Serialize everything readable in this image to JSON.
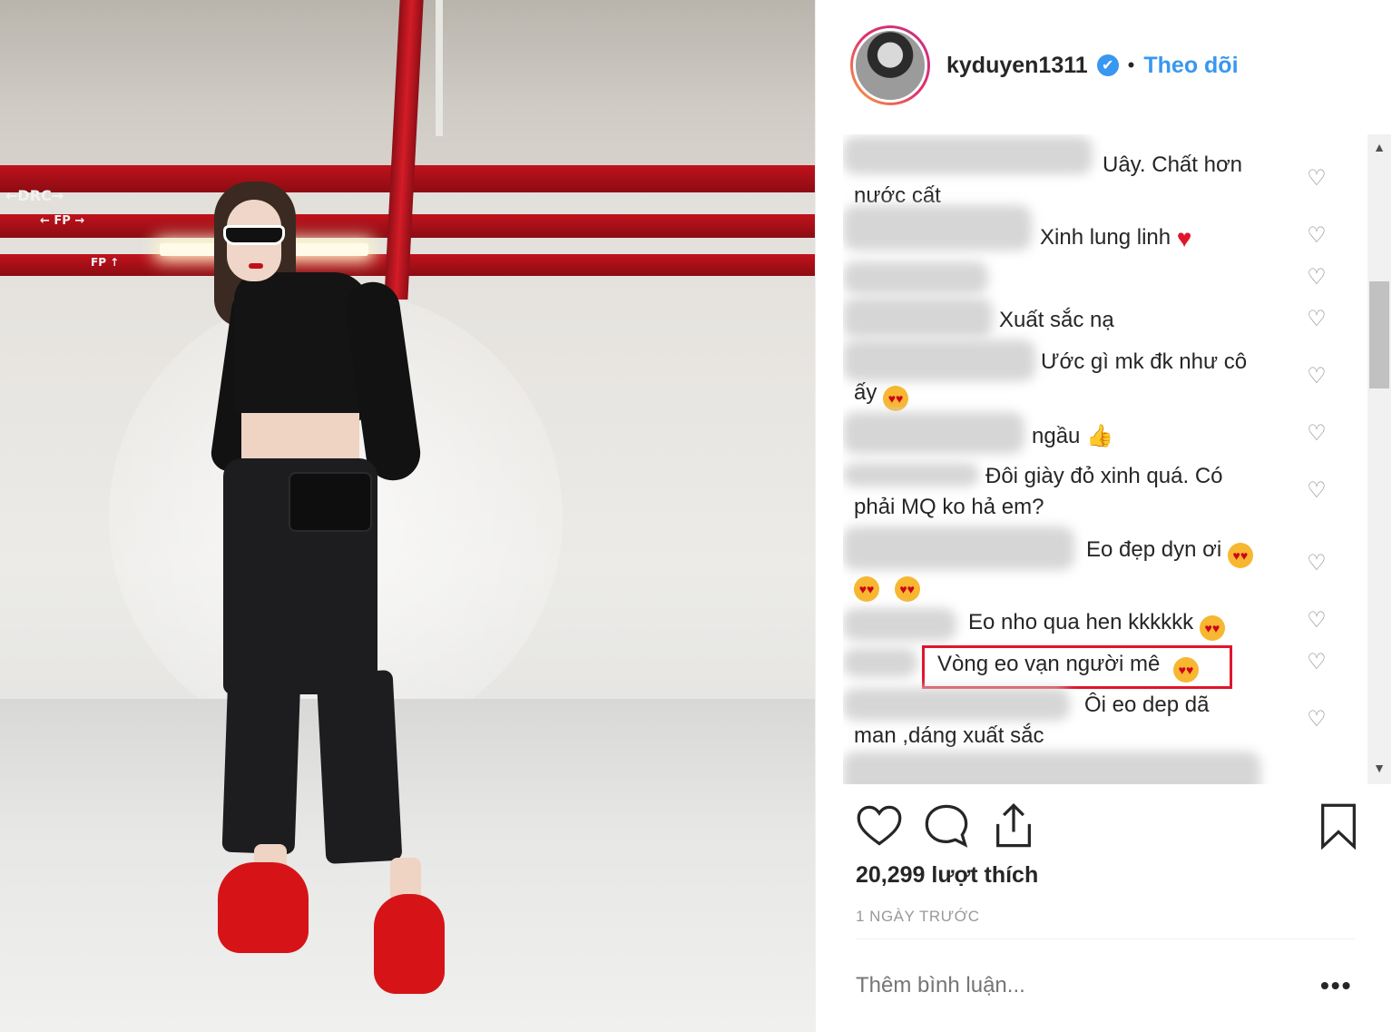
{
  "photo": {
    "signs": [
      "←DRC→",
      "← FP →",
      "FP ↑"
    ]
  },
  "header": {
    "username": "kyduyen1311",
    "verified_mark": "✔",
    "separator": "•",
    "follow_label": "Theo dõi"
  },
  "comments": [
    {
      "text": "Uây. Chất hơn",
      "text2": "nước cất"
    },
    {
      "text": "Xinh lung linh",
      "emoji": "red-heart"
    },
    {
      "text": ""
    },
    {
      "text": "Xuất sắc nạ"
    },
    {
      "text": "Ước gì mk đk như cô",
      "text2": "ấy",
      "emoji": "heart-eyes"
    },
    {
      "text": "ngầu",
      "emoji": "thumbs-up"
    },
    {
      "text": "Đôi giày đỏ xinh quá. Có",
      "text2": "phải MQ ko hả em?"
    },
    {
      "text": "Eo đẹp dyn ơi",
      "emoji": "heart-eyes"
    },
    {
      "text": "Eo nho qua hen kkkkkk",
      "emoji": "heart-eyes"
    },
    {
      "text": "Vòng eo vạn người mê",
      "emoji": "heart-eyes",
      "highlighted": true
    },
    {
      "text": "Ôi eo dep dã",
      "text2": "man ,dáng xuất sắc"
    }
  ],
  "likes": "20,299 lượt thích",
  "time": "1 NGÀY TRƯỚC",
  "add_comment_placeholder": "Thêm bình luận...",
  "more_label": "•••",
  "colors": {
    "accent": "#3897f0",
    "highlight_border": "#e0152b",
    "muted": "#999999",
    "text": "#262626"
  },
  "icons": [
    "heart-icon",
    "comment-icon",
    "share-icon",
    "bookmark-icon",
    "verified-badge-icon"
  ]
}
